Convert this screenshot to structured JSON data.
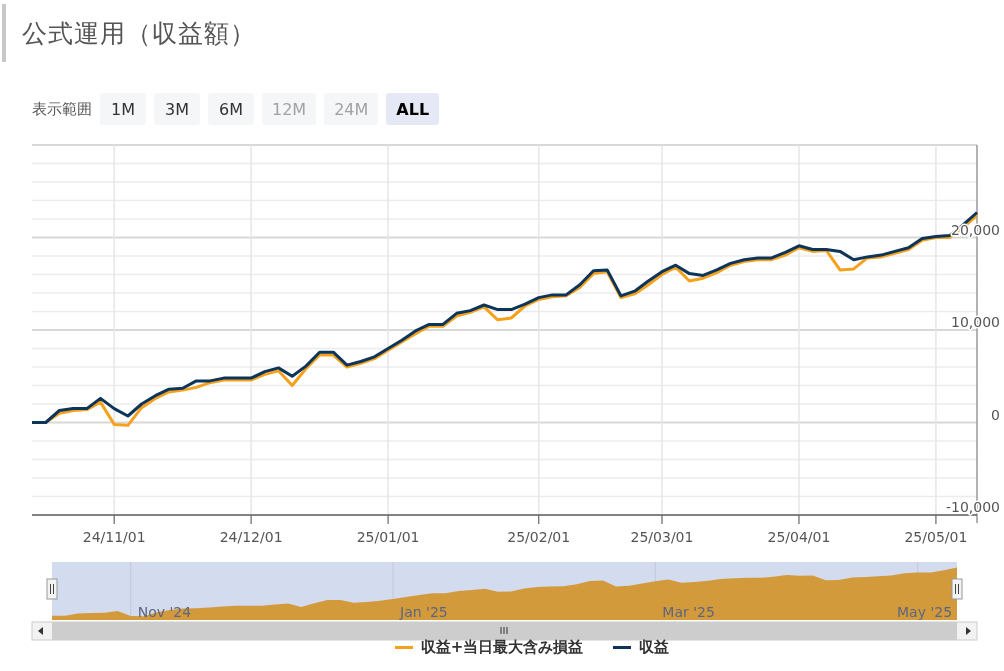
{
  "title": "公式運用（収益額）",
  "range_selector": {
    "label": "表示範囲",
    "buttons": [
      {
        "label": "1M",
        "selected": false,
        "disabled": false
      },
      {
        "label": "3M",
        "selected": false,
        "disabled": false
      },
      {
        "label": "6M",
        "selected": false,
        "disabled": false
      },
      {
        "label": "12M",
        "selected": false,
        "disabled": true
      },
      {
        "label": "24M",
        "selected": false,
        "disabled": true
      },
      {
        "label": "ALL",
        "selected": true,
        "disabled": false
      }
    ]
  },
  "chart": {
    "chart_data": {
      "type": "line",
      "grid": true,
      "categories": [
        null,
        null,
        null,
        null,
        null,
        null,
        "24/11/01",
        null,
        null,
        null,
        null,
        null,
        null,
        null,
        null,
        null,
        "24/12/01",
        null,
        null,
        null,
        null,
        null,
        null,
        null,
        null,
        null,
        "25/01/01",
        null,
        null,
        null,
        null,
        null,
        null,
        null,
        null,
        null,
        null,
        "25/02/01",
        null,
        null,
        null,
        null,
        null,
        null,
        null,
        null,
        "25/03/01",
        null,
        null,
        null,
        null,
        null,
        null,
        null,
        null,
        null,
        "25/04/01",
        null,
        null,
        null,
        null,
        null,
        null,
        null,
        null,
        null,
        "25/05/01",
        null,
        null,
        null
      ],
      "series": [
        {
          "name": "収益+当日最大含み損益",
          "color": "#f5a11c",
          "values": [
            0,
            0,
            1000,
            1300,
            1400,
            2200,
            -200,
            -300,
            1600,
            2600,
            3300,
            3500,
            3800,
            4300,
            4600,
            4600,
            4600,
            5200,
            5600,
            4000,
            5800,
            7300,
            7300,
            6000,
            6400,
            6900,
            7800,
            8700,
            9600,
            10400,
            10400,
            11500,
            11900,
            12500,
            11100,
            11300,
            12600,
            13300,
            13600,
            13700,
            14600,
            16100,
            16300,
            13500,
            13900,
            14900,
            16000,
            16800,
            15300,
            15600,
            16200,
            17000,
            17400,
            17600,
            17600,
            18100,
            18900,
            18500,
            18600,
            16500,
            16600,
            17800,
            17900,
            18300,
            18700,
            19700,
            20000,
            20000,
            21100,
            22400
          ]
        },
        {
          "name": "収益",
          "color": "#0d3559",
          "values": [
            0,
            0,
            1300,
            1500,
            1500,
            2600,
            1500,
            700,
            2000,
            2900,
            3600,
            3700,
            4500,
            4500,
            4800,
            4800,
            4800,
            5500,
            5900,
            5000,
            6100,
            7600,
            7600,
            6200,
            6600,
            7100,
            8000,
            8900,
            9900,
            10600,
            10600,
            11800,
            12100,
            12700,
            12200,
            12200,
            12800,
            13500,
            13800,
            13800,
            14900,
            16400,
            16500,
            13700,
            14200,
            15300,
            16300,
            17000,
            16100,
            15900,
            16500,
            17200,
            17600,
            17800,
            17800,
            18400,
            19100,
            18700,
            18700,
            18500,
            17600,
            17900,
            18100,
            18500,
            18900,
            19900,
            20100,
            20200,
            21400,
            22700
          ]
        }
      ],
      "ylim": [
        -10000,
        30000
      ],
      "yticks": [
        {
          "value": -10000,
          "label": "-10,000"
        },
        {
          "value": 0,
          "label": "0"
        },
        {
          "value": 10000,
          "label": "10,000"
        },
        {
          "value": 20000,
          "label": "20,000"
        }
      ]
    }
  },
  "navigator": {
    "labels": [
      "Nov '24",
      "Jan '25",
      "Mar '25",
      "May '25"
    ]
  }
}
